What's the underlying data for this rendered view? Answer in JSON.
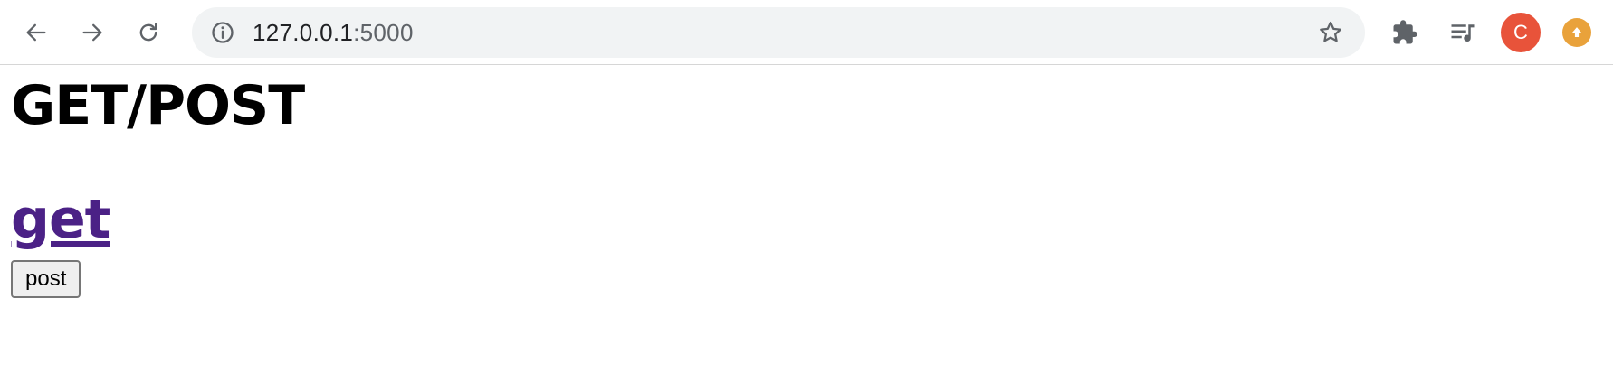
{
  "browser": {
    "url_host": "127.0.0.1",
    "url_port": ":5000",
    "avatar_initial": "C",
    "icons": {
      "back": "back-arrow-icon",
      "forward": "forward-arrow-icon",
      "reload": "reload-icon",
      "info": "info-icon",
      "star": "bookmark-star-icon",
      "extensions": "extensions-puzzle-icon",
      "media": "media-queue-icon",
      "update": "update-arrow-icon"
    },
    "colors": {
      "avatar": "#e8533a",
      "update": "#e9a23b",
      "omnibox": "#f1f3f4"
    }
  },
  "page": {
    "title": "GET/POST",
    "get_link": "get",
    "post_button": "post",
    "colors": {
      "link": "#4b2186"
    }
  }
}
